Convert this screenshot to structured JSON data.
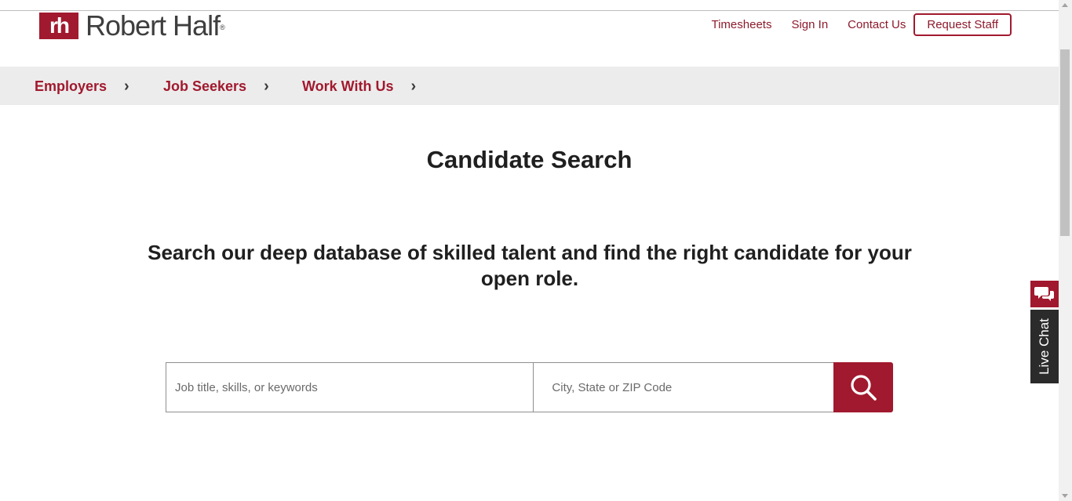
{
  "colors": {
    "brand": "#a1192e",
    "nav_bg": "#ececec",
    "live_chat_tab": "#2b2b2b"
  },
  "logo": {
    "mark": "rh",
    "name": "Robert Half",
    "registered": "®"
  },
  "utility_nav": {
    "timesheets": "Timesheets",
    "sign_in": "Sign In",
    "contact_us": "Contact Us",
    "request_staff": "Request Staff"
  },
  "main_nav": [
    {
      "label": "Employers",
      "icon": "chevron-right-icon"
    },
    {
      "label": "Job Seekers",
      "icon": "chevron-right-icon"
    },
    {
      "label": "Work With Us",
      "icon": "chevron-right-icon"
    }
  ],
  "page": {
    "title": "Candidate Search",
    "subtitle": "Search our deep database of skilled talent and find the right candidate for your open role."
  },
  "search": {
    "keywords_placeholder": "Job title, skills, or keywords",
    "location_placeholder": "City, State or ZIP Code",
    "button_icon": "search-icon"
  },
  "live_chat": {
    "label": "Live Chat",
    "icon": "chat-bubbles-icon"
  }
}
